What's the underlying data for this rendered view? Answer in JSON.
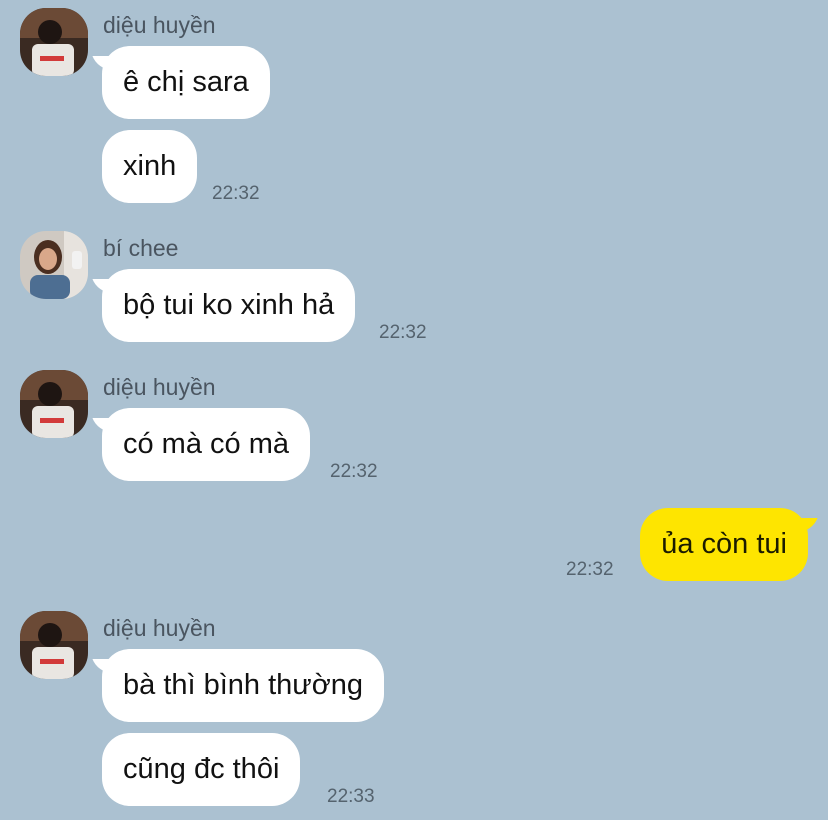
{
  "messages": [
    {
      "sender": "diệu huyền",
      "bubbles": [
        "ê chị sara",
        "xinh"
      ],
      "time": "22:32"
    },
    {
      "sender": "bí chee",
      "bubbles": [
        "bộ tui ko xinh hả"
      ],
      "time": "22:32"
    },
    {
      "sender": "diệu huyền",
      "bubbles": [
        "có mà có mà"
      ],
      "time": "22:32"
    },
    {
      "sender": "me",
      "bubbles": [
        "ủa còn tui"
      ],
      "time": "22:32"
    },
    {
      "sender": "diệu huyền",
      "bubbles": [
        "bà thì bình thường",
        "cũng đc thôi"
      ],
      "time": "22:33"
    }
  ],
  "colors": {
    "background": "#abc1d1",
    "incoming_bubble": "#ffffff",
    "outgoing_bubble": "#fee500"
  }
}
